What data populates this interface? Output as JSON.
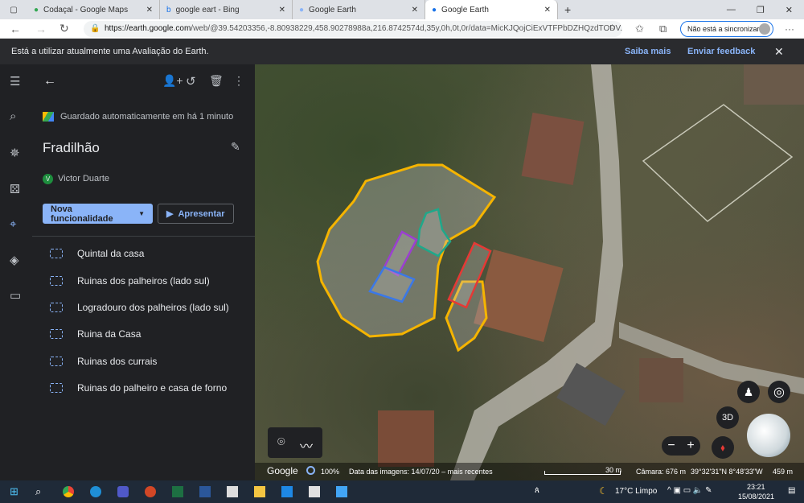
{
  "browser": {
    "tabs": [
      {
        "title": "Codaçal - Google Maps"
      },
      {
        "title": "google eart - Bing"
      },
      {
        "title": "Google Earth"
      },
      {
        "title": "Google Earth",
        "active": true
      }
    ],
    "url_host": "https://earth.google.com",
    "url_rest": "/web/@39.54203356,-8.80938229,458.90278988a,216.8742574d,35y,0h,0t,0r/data=MicKJQojCiExVTFPbDZHQzdTODV...",
    "sync_label": "Não está a sincronizar"
  },
  "banner": {
    "text": "Está a utilizar atualmente uma Avaliação do Earth.",
    "learn_more": "Saiba mais",
    "feedback": "Enviar feedback"
  },
  "panel": {
    "saved": "Guardado automaticamente em há 1 minuto",
    "title": "Fradilhão",
    "author": "Victor Duarte",
    "author_initial": "V",
    "new_feature": "Nova funcionalidade",
    "present": "Apresentar",
    "items": [
      "Quintal da casa",
      "Ruinas dos palheiros (lado sul)",
      "Logradouro dos palheiros (lado sul)",
      "Ruina da Casa",
      "Ruinas dos currais",
      "Ruinas do palheiro e casa de forno"
    ]
  },
  "map": {
    "logo": "Google",
    "zoom": "100%",
    "imagery_date": "Data das imagens: 14/07/20 – mais recentes",
    "scale": "30 m",
    "camera": "Câmara: 676 m",
    "coords": "39°32'31\"N 8°48'33\"W",
    "elevation": "459 m",
    "btn_3d": "3D",
    "polygon_colors": {
      "outline_main": "#f5b400",
      "green": "#1fa88a",
      "purple": "#9b3fd1",
      "blue": "#3b78e7",
      "red": "#e53935"
    }
  },
  "taskbar": {
    "weather": "17°C  Limpo",
    "time": "23:21",
    "date": "15/08/2021"
  }
}
